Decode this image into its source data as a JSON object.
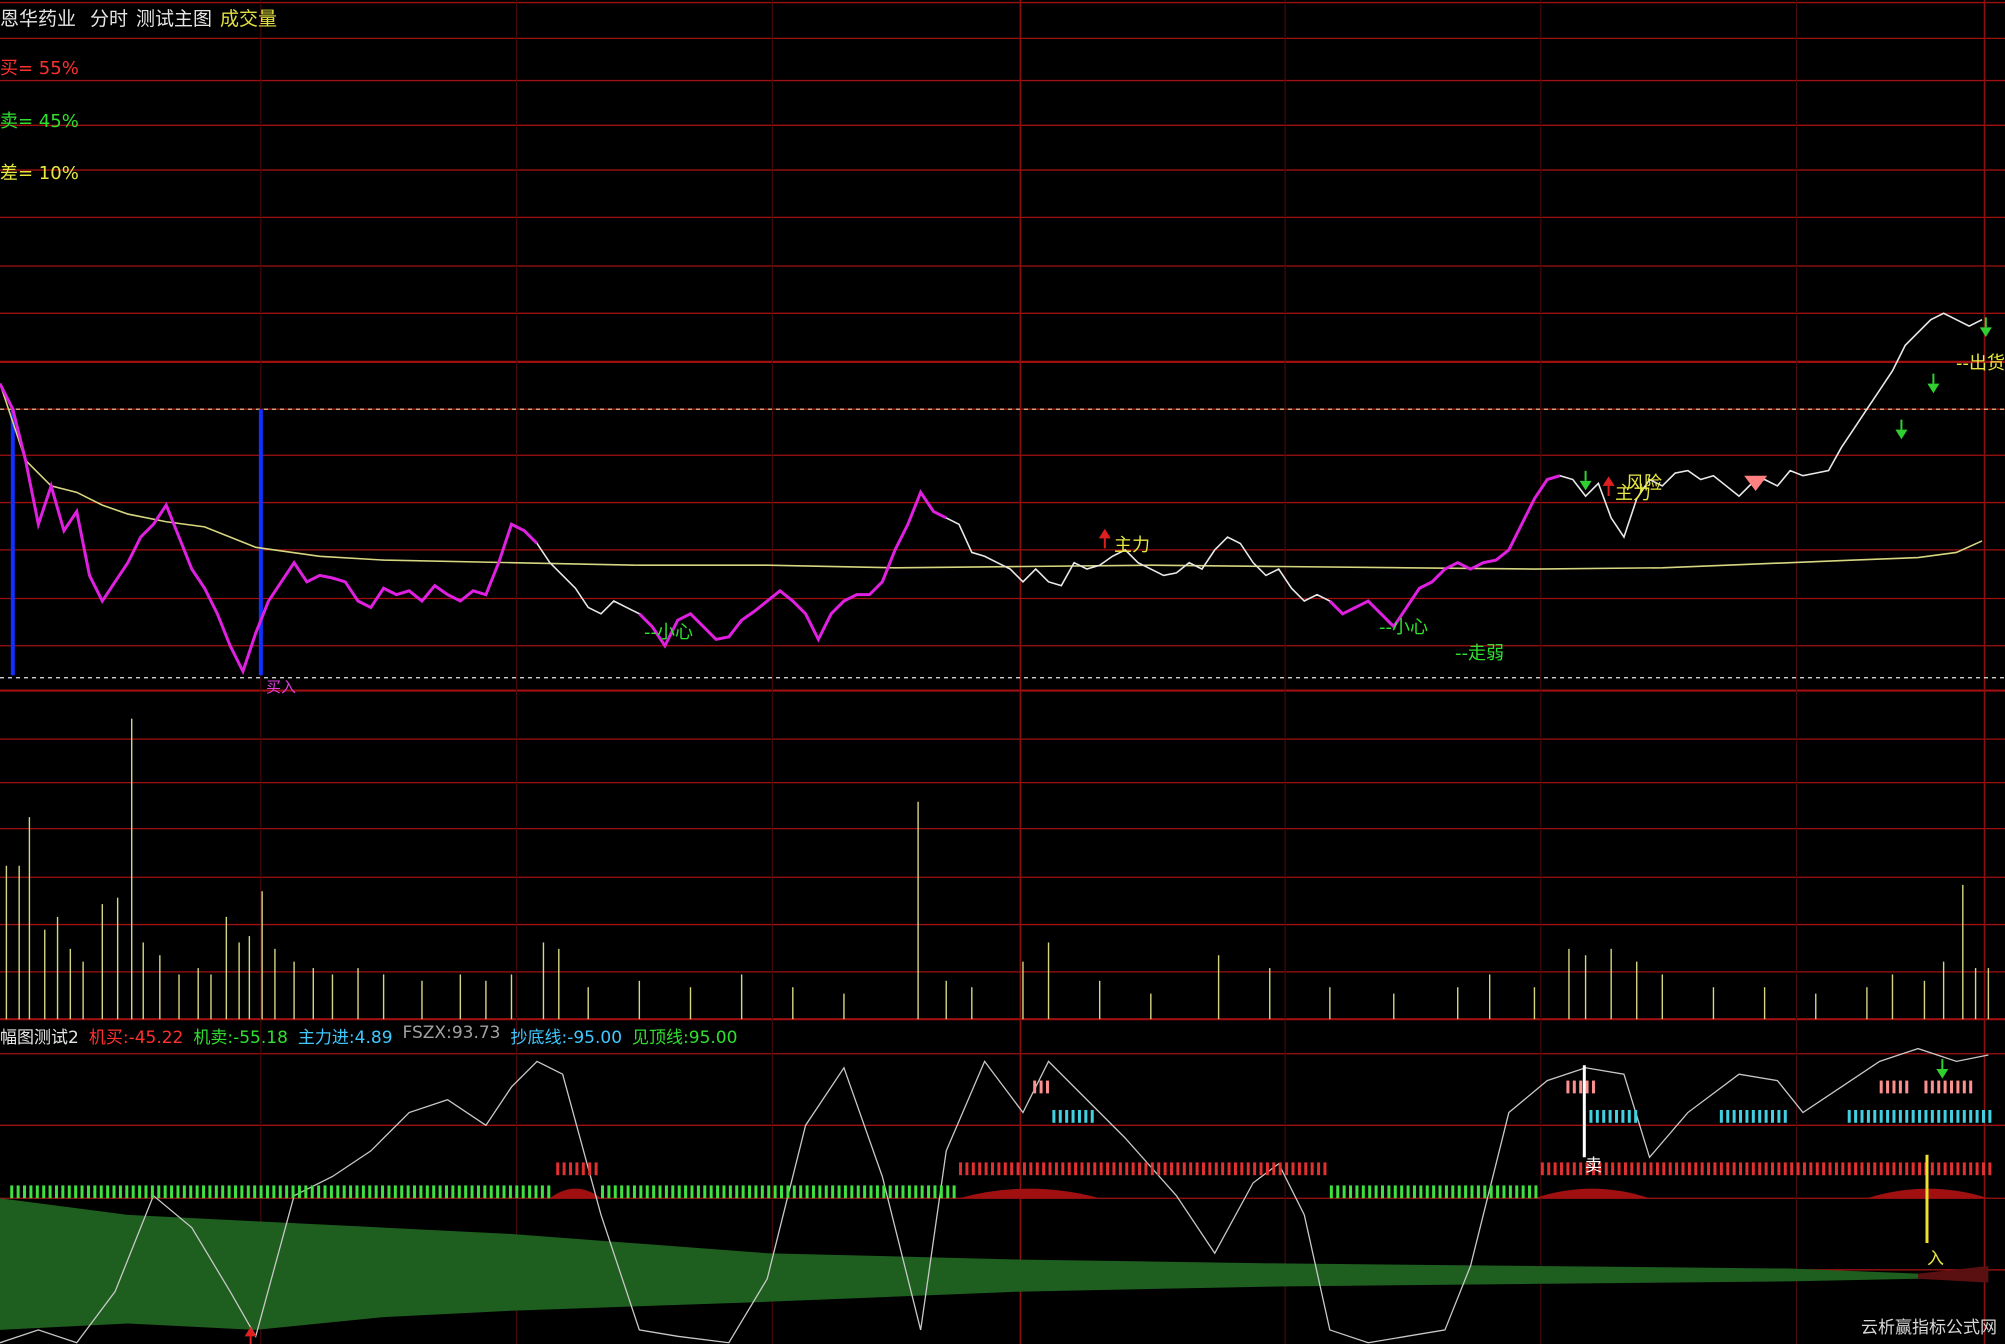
{
  "header": {
    "stock_name": "恩华药业",
    "tab_intraday": "分时",
    "tab_test_main": "测试主图",
    "tab_volume": "成交量"
  },
  "main_panel": {
    "buy_label": "买= 55%",
    "sell_label": "卖= 45%",
    "diff_label": "差= 10%",
    "annotations": {
      "buy_in": "买入",
      "careful_1": "--小心",
      "careful_2": "--小心",
      "weak": "--走弱",
      "main_force_1": "主力",
      "risk": "风险",
      "main_force_2": "主力",
      "ship_out": "--出货"
    }
  },
  "indicator_panel": {
    "name": "幅图测试2",
    "items": [
      {
        "label": "机买:",
        "value": "-45.22",
        "color": "#ff3030"
      },
      {
        "label": "机卖:",
        "value": "-55.18",
        "color": "#30e030"
      },
      {
        "label": "主力进:",
        "value": "4.89",
        "color": "#40c8ff"
      },
      {
        "label": "FSZX:",
        "value": "93.73",
        "color": "#a0a0a0"
      },
      {
        "label": "抄底线:",
        "value": "-95.00",
        "color": "#40c8ff"
      },
      {
        "label": "见顶线:",
        "value": "95.00",
        "color": "#30e030"
      }
    ],
    "sell_marker": "卖",
    "enter_marker": "入"
  },
  "watermark": "云析赢指标公式网",
  "chart_data": {
    "type": "line",
    "price_series": [
      {
        "name": "price",
        "x": [
          0,
          10,
          20,
          30,
          40,
          50,
          60,
          70,
          80,
          90,
          100,
          110,
          120,
          130,
          140,
          150,
          160,
          170,
          180,
          190,
          200,
          210,
          220,
          230,
          240,
          250,
          260,
          270,
          280,
          290,
          300,
          310,
          320,
          330,
          340,
          350,
          360,
          370,
          380,
          390,
          400,
          410,
          420,
          430,
          440,
          450,
          460,
          470,
          480,
          490,
          500,
          510,
          520,
          530,
          540,
          550,
          560,
          570,
          580,
          590,
          600,
          610,
          620,
          630,
          640,
          650,
          660,
          670,
          680,
          690,
          700,
          710,
          720,
          730,
          740,
          750,
          760,
          770,
          780,
          790,
          800,
          810,
          820,
          830,
          840,
          850,
          860,
          870,
          880,
          890,
          900,
          910,
          920,
          930,
          940,
          950,
          960,
          970,
          980,
          990,
          1000,
          1010,
          1020,
          1030,
          1040,
          1050,
          1060,
          1070,
          1080,
          1090,
          1100,
          1110,
          1120,
          1130,
          1140,
          1150,
          1160,
          1170,
          1180,
          1190,
          1200,
          1210,
          1220,
          1230,
          1240,
          1250,
          1260,
          1270,
          1280,
          1290,
          1300,
          1310,
          1320,
          1330,
          1340,
          1350,
          1360,
          1370,
          1380,
          1390,
          1400,
          1410,
          1420,
          1430,
          1440,
          1450,
          1460,
          1470,
          1480,
          1490,
          1500,
          1510,
          1520,
          1530,
          1540,
          1550
        ],
        "y": [
          300,
          320,
          360,
          410,
          380,
          415,
          400,
          450,
          470,
          455,
          440,
          420,
          410,
          395,
          420,
          445,
          460,
          480,
          505,
          525,
          495,
          470,
          455,
          440,
          455,
          450,
          452,
          455,
          470,
          475,
          460,
          465,
          462,
          470,
          458,
          465,
          470,
          462,
          465,
          440,
          410,
          415,
          425,
          440,
          450,
          460,
          475,
          480,
          470,
          475,
          480,
          490,
          505,
          485,
          480,
          490,
          500,
          498,
          485,
          478,
          470,
          462,
          470,
          480,
          500,
          480,
          470,
          465,
          465,
          455,
          430,
          410,
          385,
          400,
          405,
          410,
          432,
          435,
          440,
          445,
          455,
          445,
          455,
          458,
          440,
          445,
          442,
          435,
          430,
          440,
          445,
          450,
          448,
          440,
          445,
          430,
          420,
          425,
          440,
          450,
          445,
          460,
          470,
          465,
          470,
          480,
          475,
          470,
          480,
          490,
          475,
          460,
          455,
          445,
          440,
          445,
          440,
          438,
          430,
          410,
          390,
          375,
          372,
          375,
          388,
          378,
          405,
          420,
          390,
          375,
          380,
          370,
          368,
          375,
          372,
          380,
          388,
          378,
          375,
          380,
          368,
          372,
          370,
          368,
          350,
          335,
          320,
          305,
          290,
          270,
          260,
          250,
          245,
          250,
          255,
          250
        ],
        "color": "#e8e8e8"
      },
      {
        "name": "avg",
        "x": [
          0,
          20,
          40,
          60,
          80,
          100,
          130,
          160,
          200,
          250,
          300,
          400,
          500,
          600,
          700,
          800,
          900,
          1000,
          1100,
          1200,
          1300,
          1400,
          1450,
          1500,
          1530,
          1550
        ],
        "y": [
          300,
          360,
          380,
          385,
          395,
          402,
          408,
          412,
          428,
          435,
          438,
          440,
          442,
          442,
          444,
          443,
          442,
          443,
          444,
          445,
          444,
          440,
          438,
          436,
          432,
          423
        ],
        "color": "#d6d680"
      }
    ],
    "volume_ylim": [
      0,
      100
    ],
    "oscillator_ylim": [
      -100,
      100
    ],
    "reference_lines": {
      "bottom_line": -95.0,
      "top_line": 95.0
    }
  }
}
